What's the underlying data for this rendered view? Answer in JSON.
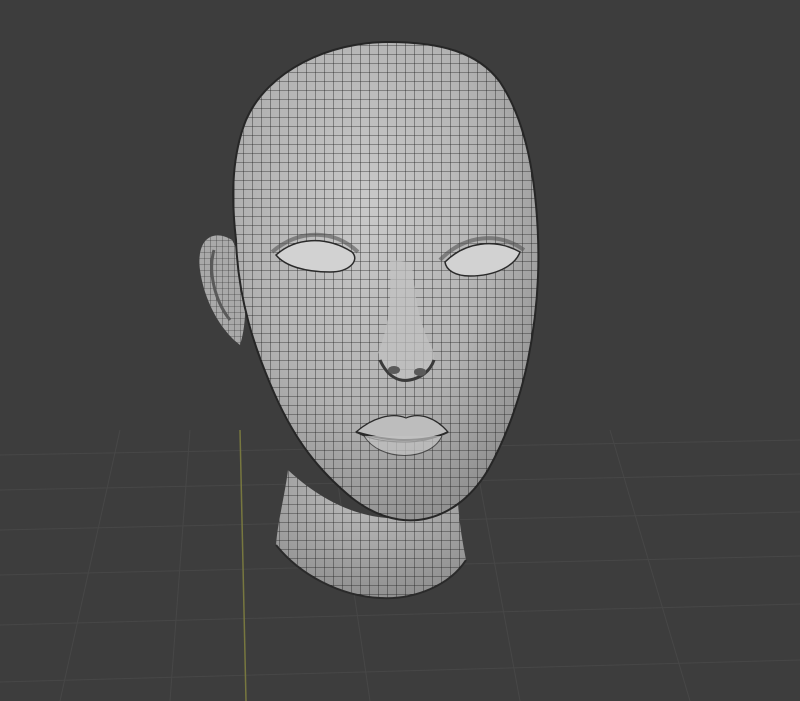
{
  "viewport": {
    "background_color": "#3d3d3d",
    "grid_line_color": "#484848",
    "axis_line_color": "#7a7a45",
    "mesh_fill_color": "#b9b9b9",
    "mesh_shadow_color": "#6a6a6a",
    "wireframe_color": "#1e1e1e",
    "object": "head-mesh"
  }
}
